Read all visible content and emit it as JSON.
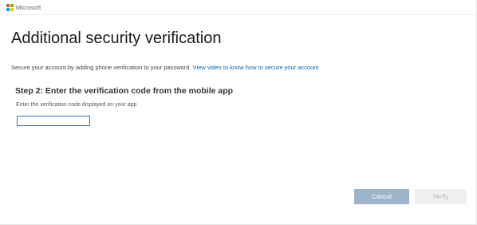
{
  "header": {
    "brand_name": "Microsoft",
    "logo_colors": [
      "#f25022",
      "#7fba00",
      "#00a4ef",
      "#ffb900"
    ]
  },
  "main": {
    "title": "Additional security verification",
    "intro_text": "Secure your account by adding phone verification to your password.",
    "intro_link": "View video to know how to secure your account",
    "step_heading": "Step 2: Enter the verification code from the mobile app",
    "code_label": "Enter the verification code displayed on your app",
    "code_value": ""
  },
  "actions": {
    "cancel_label": "Cancel",
    "verify_label": "Verify"
  },
  "colors": {
    "link": "#0067b8",
    "cancel_bg": "#9cb3c9",
    "verify_bg": "#f0f0f0",
    "input_border": "#3a6ec2"
  }
}
